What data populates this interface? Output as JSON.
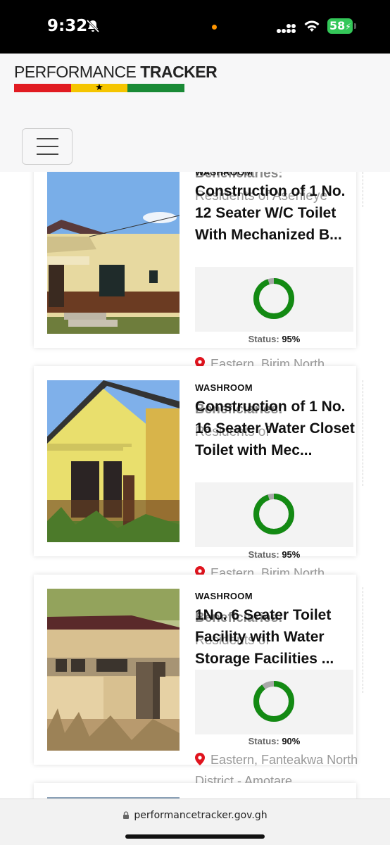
{
  "status_bar": {
    "time": "9:32",
    "battery": "58",
    "icons": [
      "bell-slash-icon",
      "signal-icon",
      "wifi-icon",
      "battery-charging-icon"
    ]
  },
  "header": {
    "logo_light": "PERFORMANCE ",
    "logo_bold": "TRACKER",
    "flag_colors": [
      "#e11b22",
      "#f5c500",
      "#1a8a36"
    ],
    "menu_icon": "hamburger-icon"
  },
  "projects": [
    {
      "category": "WASHROOM",
      "title": "Construction of 1 No. 12 Seater W/C Toilet With Mechanized B...",
      "status_label": "Status:",
      "status_value": "95%",
      "progress": 0.95,
      "ghost_heading": "Beneficiaries:",
      "ghost_text": "Residents of Asenieye",
      "location": "Eastern, Birim North District - Nweakwae"
    },
    {
      "category": "WASHROOM",
      "title": "Construction of 1 No. 16 Seater Water Closet Toilet with Mec...",
      "status_label": "Status:",
      "status_value": "95%",
      "progress": 0.95,
      "ghost_heading": "Beneficiaries:",
      "ghost_text": "Residents of",
      "location": "Eastern, Birim North District - Potwekrom"
    },
    {
      "category": "WASHROOM",
      "title": "1No. 6 Seater Toilet Facility with Water Storage Facilities ...",
      "status_label": "Status:",
      "status_value": "90%",
      "progress": 0.9,
      "ghost_heading": "Beneficiaries:",
      "ghost_text": "Residents of",
      "location": "Eastern, Fanteakwa North District - Amotare"
    }
  ],
  "colors": {
    "progress": "#138a13",
    "remaining": "#a8a8a8",
    "pin": "#e0141e"
  },
  "urlbar": {
    "url": "performancetracker.gov.gh"
  }
}
